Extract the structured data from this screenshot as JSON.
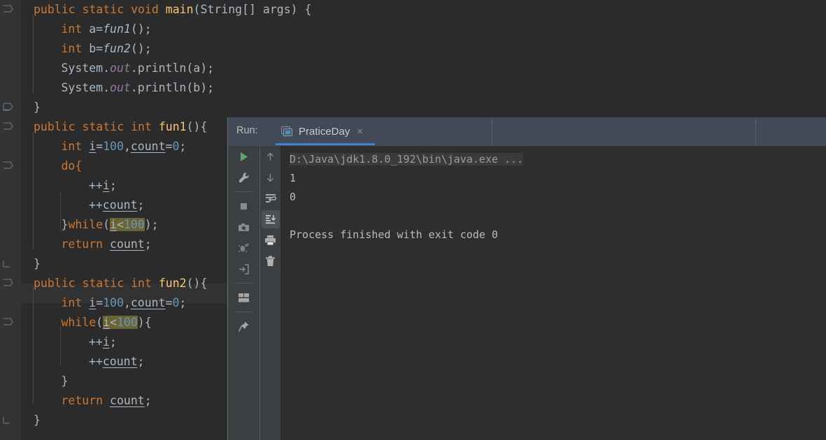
{
  "app": {
    "theme": "darcula",
    "colors": {
      "editor_bg": "#2b2b2b",
      "gutter_bg": "#313335",
      "panel_bg": "#2e2e2e",
      "toolbar_bg": "#3c3f41",
      "header_bg": "#414a56",
      "keyword": "#cc7832",
      "number": "#6897bb",
      "method": "#ffc66d",
      "field": "#9876aa",
      "text": "#a9b7c6",
      "tab_underline": "#3d82d6",
      "warning_highlight": "#6b6330",
      "current_line": "#323232",
      "run_green": "#59a869"
    }
  },
  "editor": {
    "language": "java",
    "lines": [
      {
        "indent": 0,
        "fold": true,
        "tokens": [
          {
            "t": "public",
            "c": "kw"
          },
          {
            "t": " ",
            "c": ""
          },
          {
            "t": "static",
            "c": "kw"
          },
          {
            "t": " ",
            "c": ""
          },
          {
            "t": "void",
            "c": "kw"
          },
          {
            "t": " ",
            "c": ""
          },
          {
            "t": "main",
            "c": "meth"
          },
          {
            "t": "(",
            "c": ""
          },
          {
            "t": "String",
            "c": "ident"
          },
          {
            "t": "[] ",
            "c": ""
          },
          {
            "t": "args",
            "c": "ident"
          },
          {
            "t": ") {",
            "c": ""
          }
        ]
      },
      {
        "indent": 1,
        "fold": false,
        "tokens": [
          {
            "t": "int",
            "c": "kw"
          },
          {
            "t": " a=",
            "c": ""
          },
          {
            "t": "fun1",
            "c": "callit"
          },
          {
            "t": "();",
            "c": ""
          }
        ]
      },
      {
        "indent": 1,
        "fold": false,
        "tokens": [
          {
            "t": "int",
            "c": "kw"
          },
          {
            "t": " b=",
            "c": ""
          },
          {
            "t": "fun2",
            "c": "callit"
          },
          {
            "t": "();",
            "c": ""
          }
        ]
      },
      {
        "indent": 1,
        "fold": false,
        "tokens": [
          {
            "t": "System.",
            "c": ""
          },
          {
            "t": "out",
            "c": "field"
          },
          {
            "t": ".println(a);",
            "c": ""
          }
        ]
      },
      {
        "indent": 1,
        "fold": false,
        "tokens": [
          {
            "t": "System.",
            "c": ""
          },
          {
            "t": "out",
            "c": "field"
          },
          {
            "t": ".println(b);",
            "c": ""
          }
        ]
      },
      {
        "indent": 0,
        "fold": true,
        "tokens": [
          {
            "t": "}",
            "c": ""
          }
        ]
      },
      {
        "indent": 0,
        "fold": true,
        "tokens": [
          {
            "t": "public",
            "c": "kw"
          },
          {
            "t": " ",
            "c": ""
          },
          {
            "t": "static",
            "c": "kw"
          },
          {
            "t": " ",
            "c": ""
          },
          {
            "t": "int",
            "c": "kw"
          },
          {
            "t": " ",
            "c": ""
          },
          {
            "t": "fun1",
            "c": "meth"
          },
          {
            "t": "(){",
            "c": ""
          }
        ]
      },
      {
        "indent": 1,
        "fold": false,
        "tokens": [
          {
            "t": "int",
            "c": "kw"
          },
          {
            "t": " ",
            "c": ""
          },
          {
            "t": "i",
            "c": "u"
          },
          {
            "t": "=",
            "c": ""
          },
          {
            "t": "100",
            "c": "num"
          },
          {
            "t": ",",
            "c": ""
          },
          {
            "t": "count",
            "c": "u"
          },
          {
            "t": "=",
            "c": ""
          },
          {
            "t": "0",
            "c": "num"
          },
          {
            "t": ";",
            "c": ""
          }
        ]
      },
      {
        "indent": 1,
        "fold": true,
        "tokens": [
          {
            "t": "do{",
            "c": "kw"
          }
        ]
      },
      {
        "indent": 2,
        "fold": false,
        "tokens": [
          {
            "t": "++",
            "c": ""
          },
          {
            "t": "i",
            "c": "u"
          },
          {
            "t": ";",
            "c": ""
          }
        ]
      },
      {
        "indent": 2,
        "fold": false,
        "tokens": [
          {
            "t": "++",
            "c": ""
          },
          {
            "t": "count",
            "c": "u"
          },
          {
            "t": ";",
            "c": ""
          }
        ]
      },
      {
        "indent": 1,
        "fold": false,
        "tokens": [
          {
            "t": "}",
            "c": ""
          },
          {
            "t": "while",
            "c": "kw"
          },
          {
            "t": "(",
            "c": ""
          },
          {
            "t": "i",
            "c": "warn-u"
          },
          {
            "t": "<",
            "c": "warn"
          },
          {
            "t": "100",
            "c": "warn-num"
          },
          {
            "t": ");",
            "c": ""
          }
        ]
      },
      {
        "indent": 1,
        "fold": false,
        "tokens": [
          {
            "t": "return",
            "c": "kw"
          },
          {
            "t": " ",
            "c": ""
          },
          {
            "t": "count",
            "c": "u"
          },
          {
            "t": ";",
            "c": ""
          }
        ]
      },
      {
        "indent": 0,
        "fold": false,
        "tokens": [
          {
            "t": "}",
            "c": ""
          }
        ]
      },
      {
        "indent": 0,
        "fold": true,
        "tokens": [
          {
            "t": "public",
            "c": "kw"
          },
          {
            "t": " ",
            "c": ""
          },
          {
            "t": "static",
            "c": "kw"
          },
          {
            "t": " ",
            "c": ""
          },
          {
            "t": "int",
            "c": "kw"
          },
          {
            "t": " ",
            "c": ""
          },
          {
            "t": "fun2",
            "c": "meth"
          },
          {
            "t": "(){",
            "c": ""
          }
        ]
      },
      {
        "indent": 1,
        "fold": false,
        "current": true,
        "tokens": [
          {
            "t": "int",
            "c": "kw"
          },
          {
            "t": " ",
            "c": ""
          },
          {
            "t": "i",
            "c": "u"
          },
          {
            "t": "=",
            "c": ""
          },
          {
            "t": "100",
            "c": "num"
          },
          {
            "t": ",",
            "c": ""
          },
          {
            "t": "count",
            "c": "u"
          },
          {
            "t": "=",
            "c": ""
          },
          {
            "t": "0",
            "c": "num"
          },
          {
            "t": ";",
            "c": ""
          }
        ]
      },
      {
        "indent": 1,
        "fold": true,
        "tokens": [
          {
            "t": "while",
            "c": "kw"
          },
          {
            "t": "(",
            "c": ""
          },
          {
            "t": "i",
            "c": "warn-u"
          },
          {
            "t": "<",
            "c": "warn"
          },
          {
            "t": "100",
            "c": "warn-num"
          },
          {
            "t": "){",
            "c": ""
          }
        ]
      },
      {
        "indent": 2,
        "fold": false,
        "tokens": [
          {
            "t": "++",
            "c": ""
          },
          {
            "t": "i",
            "c": "u"
          },
          {
            "t": ";",
            "c": ""
          }
        ]
      },
      {
        "indent": 2,
        "fold": false,
        "tokens": [
          {
            "t": "++",
            "c": ""
          },
          {
            "t": "count",
            "c": "u"
          },
          {
            "t": ";",
            "c": ""
          }
        ]
      },
      {
        "indent": 1,
        "fold": false,
        "tokens": [
          {
            "t": "}",
            "c": ""
          }
        ]
      },
      {
        "indent": 1,
        "fold": false,
        "tokens": [
          {
            "t": "return",
            "c": "kw"
          },
          {
            "t": " ",
            "c": ""
          },
          {
            "t": "count",
            "c": "u"
          },
          {
            "t": ";",
            "c": ""
          }
        ]
      },
      {
        "indent": 0,
        "fold": false,
        "tokens": [
          {
            "t": "}",
            "c": ""
          }
        ]
      }
    ]
  },
  "run_panel": {
    "label": "Run:",
    "tab": {
      "name": "PraticeDay",
      "icon": "run-configuration-icon",
      "close": "×",
      "selected": true
    },
    "toolbar_left": [
      {
        "name": "rerun-button",
        "icon": "play-green"
      },
      {
        "name": "edit-config-button",
        "icon": "wrench"
      },
      {
        "name": "stop-button",
        "icon": "stop-square"
      },
      {
        "name": "screenshot-button",
        "icon": "camera"
      },
      {
        "name": "rerun-failed-button",
        "icon": "rerun-failed"
      },
      {
        "name": "import-button",
        "icon": "import-arrow"
      },
      {
        "name": "layout-button",
        "icon": "layout"
      },
      {
        "name": "pin-tab-button",
        "icon": "pin"
      }
    ],
    "toolbar_right": [
      {
        "name": "up-button",
        "icon": "arrow-up",
        "active": false
      },
      {
        "name": "down-button",
        "icon": "arrow-down",
        "active": false
      },
      {
        "name": "soft-wrap-button",
        "icon": "soft-wrap",
        "active": false
      },
      {
        "name": "scroll-to-end-button",
        "icon": "scroll-to-end",
        "active": true
      },
      {
        "name": "print-button",
        "icon": "printer",
        "active": false
      },
      {
        "name": "clear-all-button",
        "icon": "trash",
        "active": false
      }
    ],
    "console": {
      "command": "D:\\Java\\jdk1.8.0_192\\bin\\java.exe ...",
      "output": [
        "1",
        "0",
        "",
        "Process finished with exit code 0"
      ]
    }
  }
}
